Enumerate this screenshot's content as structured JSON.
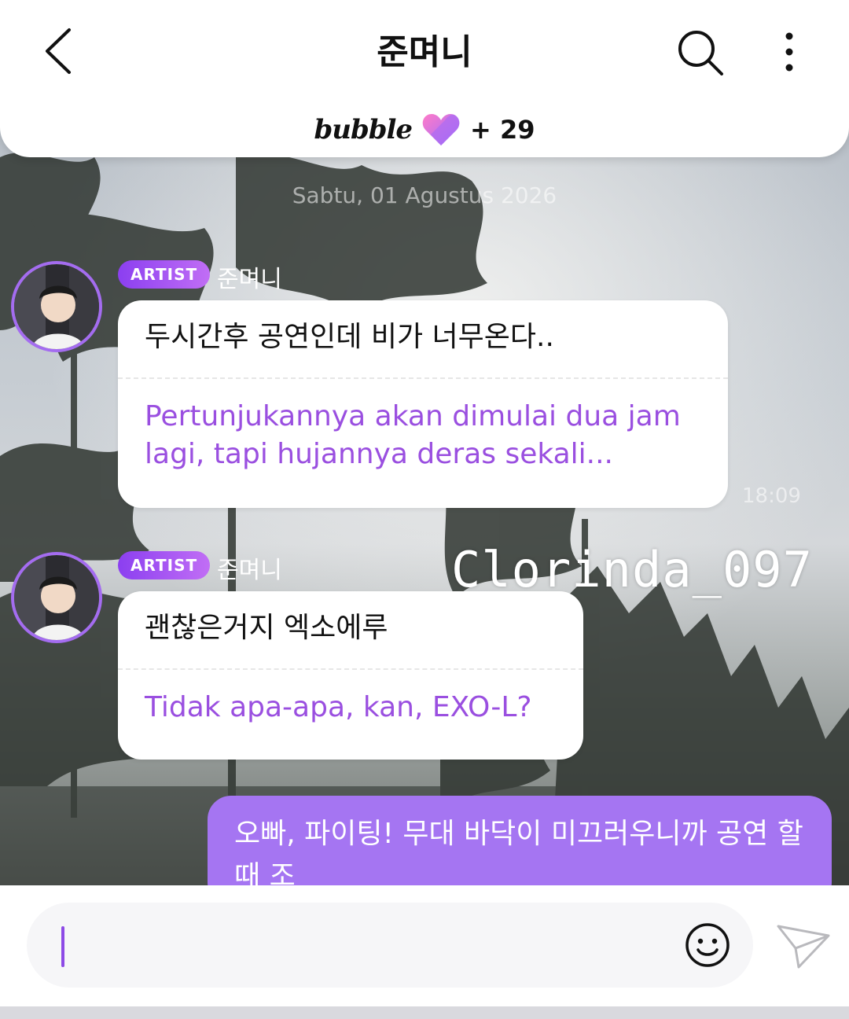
{
  "header": {
    "title": "준며니",
    "brand": "bubble",
    "extra_count": "+ 29"
  },
  "chat": {
    "date_divider": "Sabtu, 01 Agustus 2026",
    "messages": [
      {
        "badge": "ARTIST",
        "sender": "준며니",
        "original": "두시간후 공연인데 비가 너무온다..",
        "translation": "Pertunjukannya akan dimulai dua jam lagi, tapi hujannya deras sekali...",
        "time": "18:09"
      },
      {
        "badge": "ARTIST",
        "sender": "준며니",
        "original": "괜찮은거지 엑소에루",
        "translation": "Tidak apa-apa, kan, EXO-L?"
      }
    ],
    "watermark": "Clorinda_097",
    "my_message": "오빠, 파이팅! 무대 바닥이 미끄러우니까 공연 할 때 조"
  },
  "input": {
    "placeholder": ""
  },
  "colors": {
    "accent": "#9a4fe0",
    "my_bubble": "#a575f2",
    "artist_badge": "#8b3ff0"
  },
  "icons": {
    "back": "chevron-left-icon",
    "search": "search-icon",
    "more": "more-vertical-icon",
    "heart": "heart-icon",
    "emoji": "smiley-icon",
    "send": "send-icon"
  }
}
